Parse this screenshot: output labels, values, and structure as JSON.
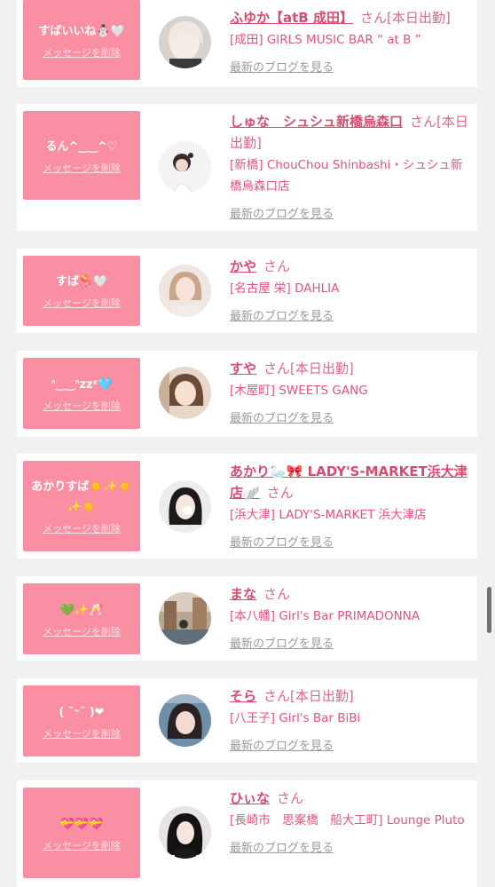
{
  "labels": {
    "delete": "メッセージを削除",
    "blog": "最新のブログを見る",
    "san": "さん"
  },
  "colors": {
    "bubble": "#fa8ea2",
    "name": "#d94b6e",
    "shop": "#e0557a",
    "link": "#9a9a9a"
  },
  "items": [
    {
      "message": "すばいいね⛄🤍",
      "name": "ふゆか【atB 成田】",
      "tag": "[本日出勤]",
      "shop": "[成田] GIRLS MUSIC BAR “ at B ”",
      "avatar_icon": "avatar-photo"
    },
    {
      "message": "るん^‿‿^♡",
      "name": "しゅな　シュシュ新橋烏森口",
      "tag": "[本日出勤]",
      "shop": "[新橋] ChouChou Shinbashi・シュシュ新橋烏森口店",
      "avatar_icon": "avatar-photo"
    },
    {
      "message": "すば🪼🤍",
      "name": "かや",
      "tag": "",
      "shop": "[名古屋 栄] DAHLIA",
      "avatar_icon": "avatar-photo"
    },
    {
      "message": "ᐢ‿‿ᐢzzᶻ🩵",
      "name": "すや",
      "tag": "[本日出勤]",
      "shop": "[木屋町] SWEETS GANG",
      "avatar_icon": "avatar-photo"
    },
    {
      "message": "あかりすば☀️✨☀️✨☀️",
      "name": "あかり🦢🎀 LADY'S-MARKET浜大津店🪽",
      "tag": "",
      "shop": "[浜大津] LADY'S-MARKET 浜大津店",
      "avatar_icon": "avatar-photo"
    },
    {
      "message": "💚✨🥂",
      "name": "まな",
      "tag": "",
      "shop": "[本八幡] Girl's Bar PRIMADONNA",
      "avatar_icon": "avatar-photo"
    },
    {
      "message": "( ˘ᵕ˘ )❤",
      "name": "そら",
      "tag": "[本日出勤]",
      "shop": "[八王子] Girl's Bar BiBi",
      "avatar_icon": "avatar-photo"
    },
    {
      "message": "💝💝💝",
      "name": "ひぃな",
      "tag": "",
      "shop": "[長崎市　思案橋　船大工町] Lounge Pluto",
      "avatar_icon": "avatar-photo"
    }
  ]
}
